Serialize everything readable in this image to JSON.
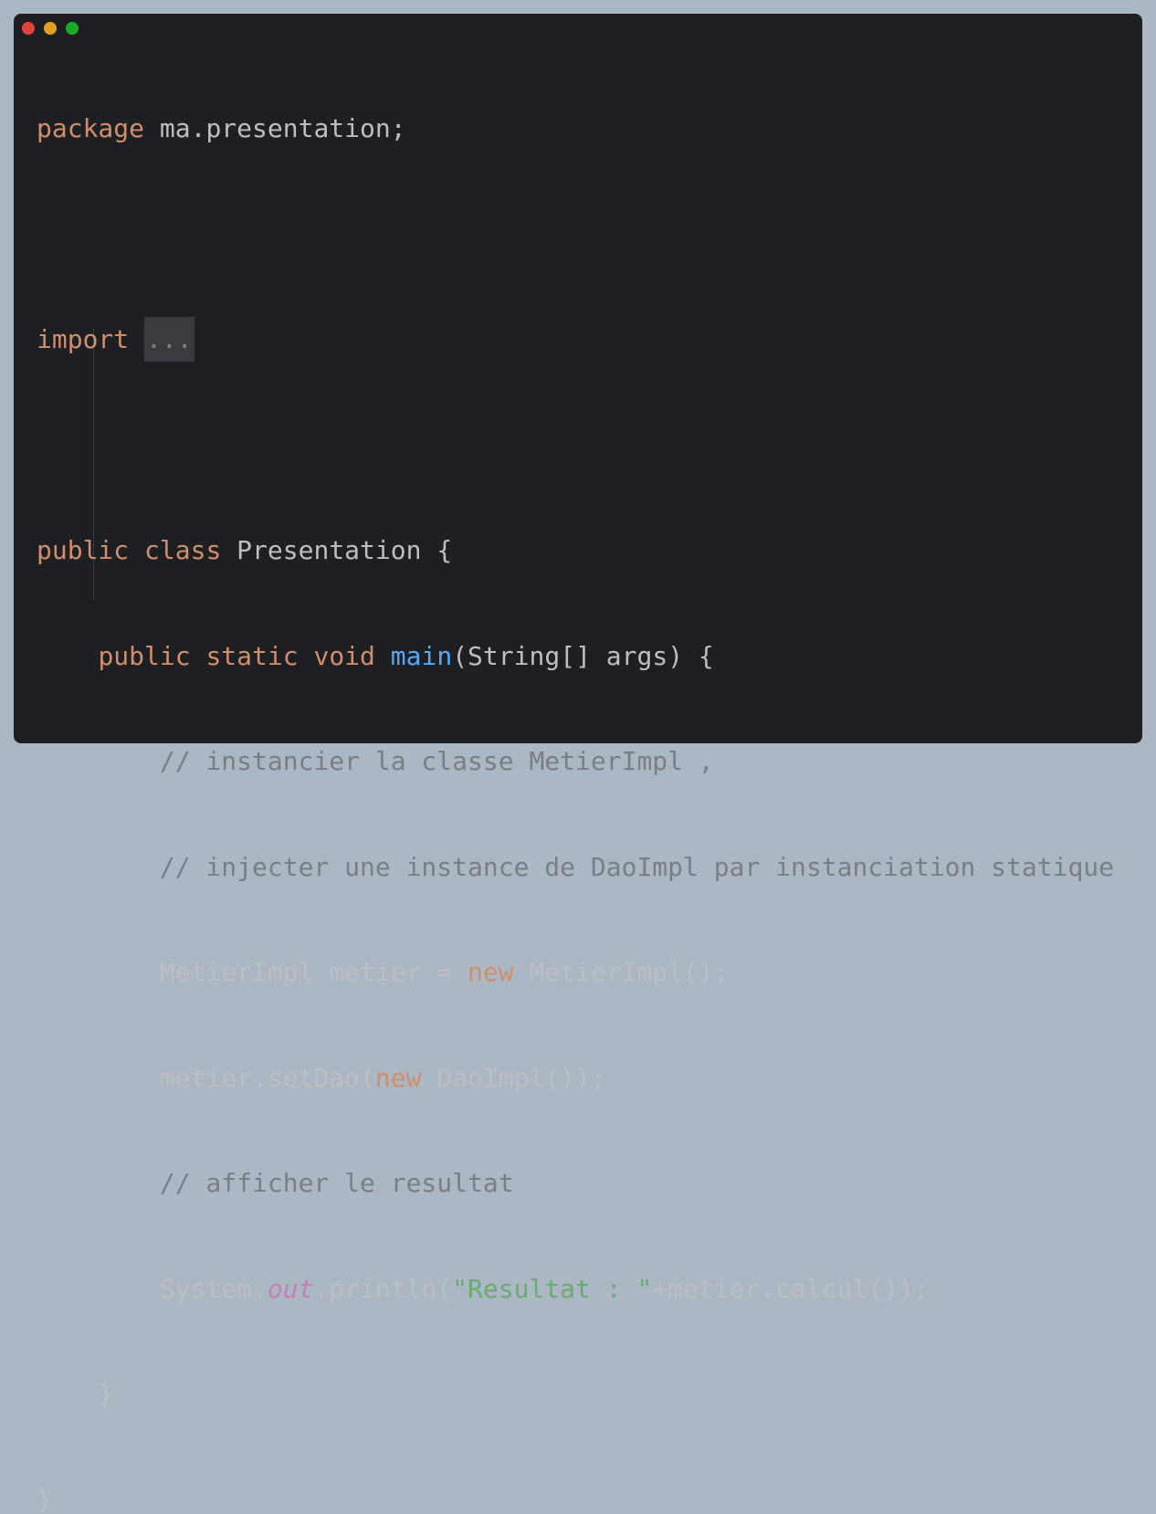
{
  "window": {
    "controls": [
      "close",
      "minimize",
      "maximize"
    ]
  },
  "code": {
    "language": "java",
    "lines": {
      "l1": {
        "kw": "package",
        "rest": " ma.presentation;"
      },
      "l3": {
        "kw": "import",
        "sp": " ",
        "fold": "..."
      },
      "l5": {
        "kw1": "public",
        "sp1": " ",
        "kw2": "class",
        "rest": " Presentation {"
      },
      "l6": {
        "indent": "    ",
        "kw1": "public",
        "sp1": " ",
        "kw2": "static",
        "sp2": " ",
        "kw3": "void",
        "sp3": " ",
        "fn": "main",
        "rest": "(String[] args) {"
      },
      "l7": {
        "indent": "        ",
        "comment": "// instancier la classe MetierImpl ,"
      },
      "l8": {
        "indent": "        ",
        "comment": "// injecter une instance de DaoImpl par instanciation statique"
      },
      "l9": {
        "indent": "        ",
        "pre": "MetierImpl metier = ",
        "kw": "new",
        "post": " MetierImpl();"
      },
      "l10": {
        "indent": "        ",
        "pre": "metier.setDao(",
        "kw": "new",
        "post": " DaoImpl());"
      },
      "l11": {
        "indent": "        ",
        "comment": "// afficher le resultat"
      },
      "l12": {
        "indent": "        ",
        "pre": "System.",
        "field": "out",
        "mid": ".println(",
        "str": "\"Resultat : \"",
        "post": "+metier.calcul());"
      },
      "l13": {
        "indent": "    ",
        "rest": "}"
      },
      "l14": {
        "rest": "}"
      }
    }
  },
  "colors": {
    "background": "#abb8c3",
    "editor": "#1e1f22",
    "keyword": "#cf8e6d",
    "function": "#56a8f5",
    "comment": "#7a7e85",
    "string": "#6aab73",
    "static_field": "#c77dbb",
    "text": "#bcbec4"
  }
}
